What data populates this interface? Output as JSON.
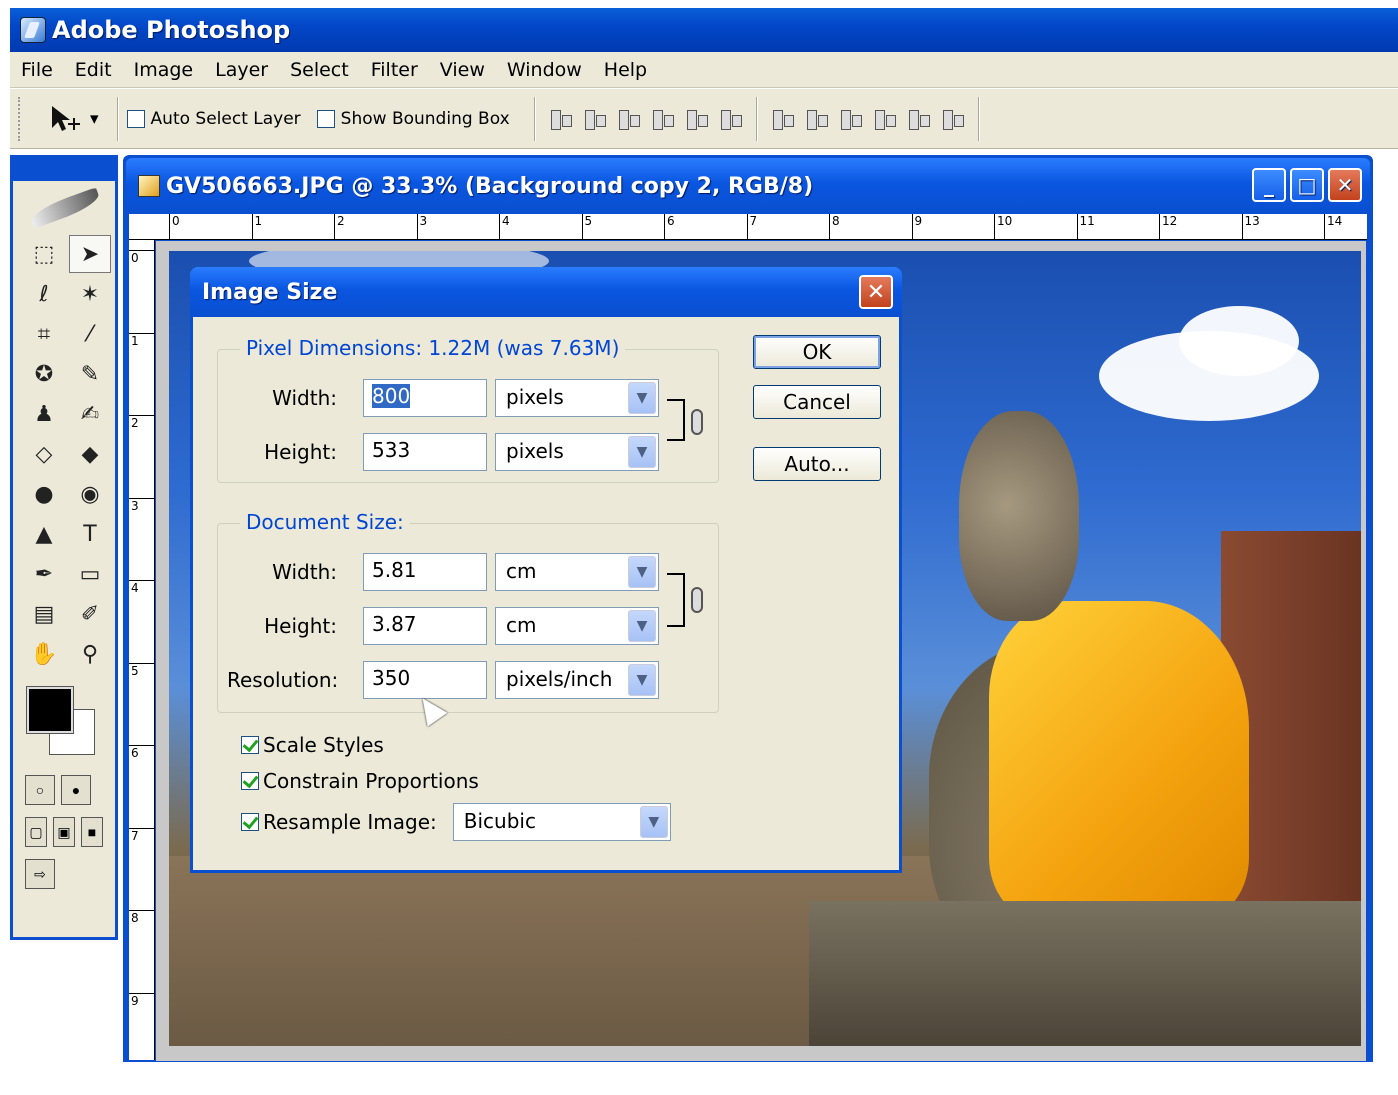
{
  "app": {
    "title": "Adobe Photoshop"
  },
  "menu": [
    "File",
    "Edit",
    "Image",
    "Layer",
    "Select",
    "Filter",
    "View",
    "Window",
    "Help"
  ],
  "options": {
    "auto_select_label": "Auto Select Layer",
    "auto_select_checked": false,
    "bounding_box_label": "Show Bounding Box",
    "bounding_box_checked": false
  },
  "document": {
    "title": "GV506663.JPG @ 33.3% (Background copy 2, RGB/8)",
    "ruler_top": [
      "0",
      "1",
      "2",
      "3",
      "4",
      "5",
      "6",
      "7",
      "8",
      "9",
      "10",
      "11",
      "12",
      "13",
      "14"
    ],
    "ruler_left": [
      "0",
      "1",
      "2",
      "3",
      "4",
      "5",
      "6",
      "7",
      "8",
      "9"
    ],
    "window_buttons": {
      "minimize": "_",
      "maximize": "□",
      "close": "✕"
    }
  },
  "dialog": {
    "title": "Image Size",
    "close_glyph": "✕",
    "pixel_dimensions": {
      "legend": "Pixel Dimensions:  1.22M (was 7.63M)",
      "width_label": "Width:",
      "width_value": "800",
      "width_unit": "pixels",
      "height_label": "Height:",
      "height_value": "533",
      "height_unit": "pixels"
    },
    "document_size": {
      "legend": "Document Size:",
      "width_label": "Width:",
      "width_value": "5.81",
      "width_unit": "cm",
      "height_label": "Height:",
      "height_value": "3.87",
      "height_unit": "cm",
      "resolution_label": "Resolution:",
      "resolution_value": "350",
      "resolution_unit": "pixels/inch"
    },
    "buttons": {
      "ok": "OK",
      "cancel": "Cancel",
      "auto": "Auto..."
    },
    "options": {
      "scale_styles": "Scale Styles",
      "constrain": "Constrain Proportions",
      "resample": "Resample Image:",
      "resample_method": "Bicubic"
    }
  },
  "icons": {
    "dropdown": "▼",
    "tool_options_arrow": "▾"
  }
}
